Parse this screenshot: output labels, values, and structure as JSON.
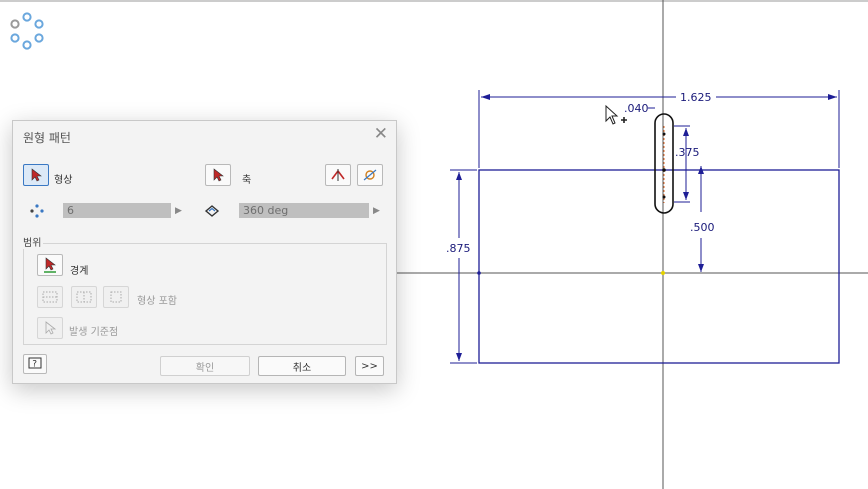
{
  "colors": {
    "sketch": "#1e1e96",
    "axis": "#505050",
    "accent": "#3a78c3",
    "dimText": "#1a1a7a"
  },
  "sketch": {
    "dims": {
      "width": "1.625",
      "gap": ".040",
      "slot": ".375",
      "offset": ".500",
      "height": ".875"
    }
  },
  "dialog": {
    "title": "원형 패턴",
    "close_icon": "close-icon",
    "shape_label": "형상",
    "axis_label": "축",
    "count_value": "6",
    "angle_value": "360 deg",
    "range_title": "범위",
    "boundary_label": "경계",
    "include_label": "형상 포함",
    "origin_label": "발생 기준점",
    "ok_label": "확인",
    "cancel_label": "취소",
    "more_label": ">>"
  }
}
